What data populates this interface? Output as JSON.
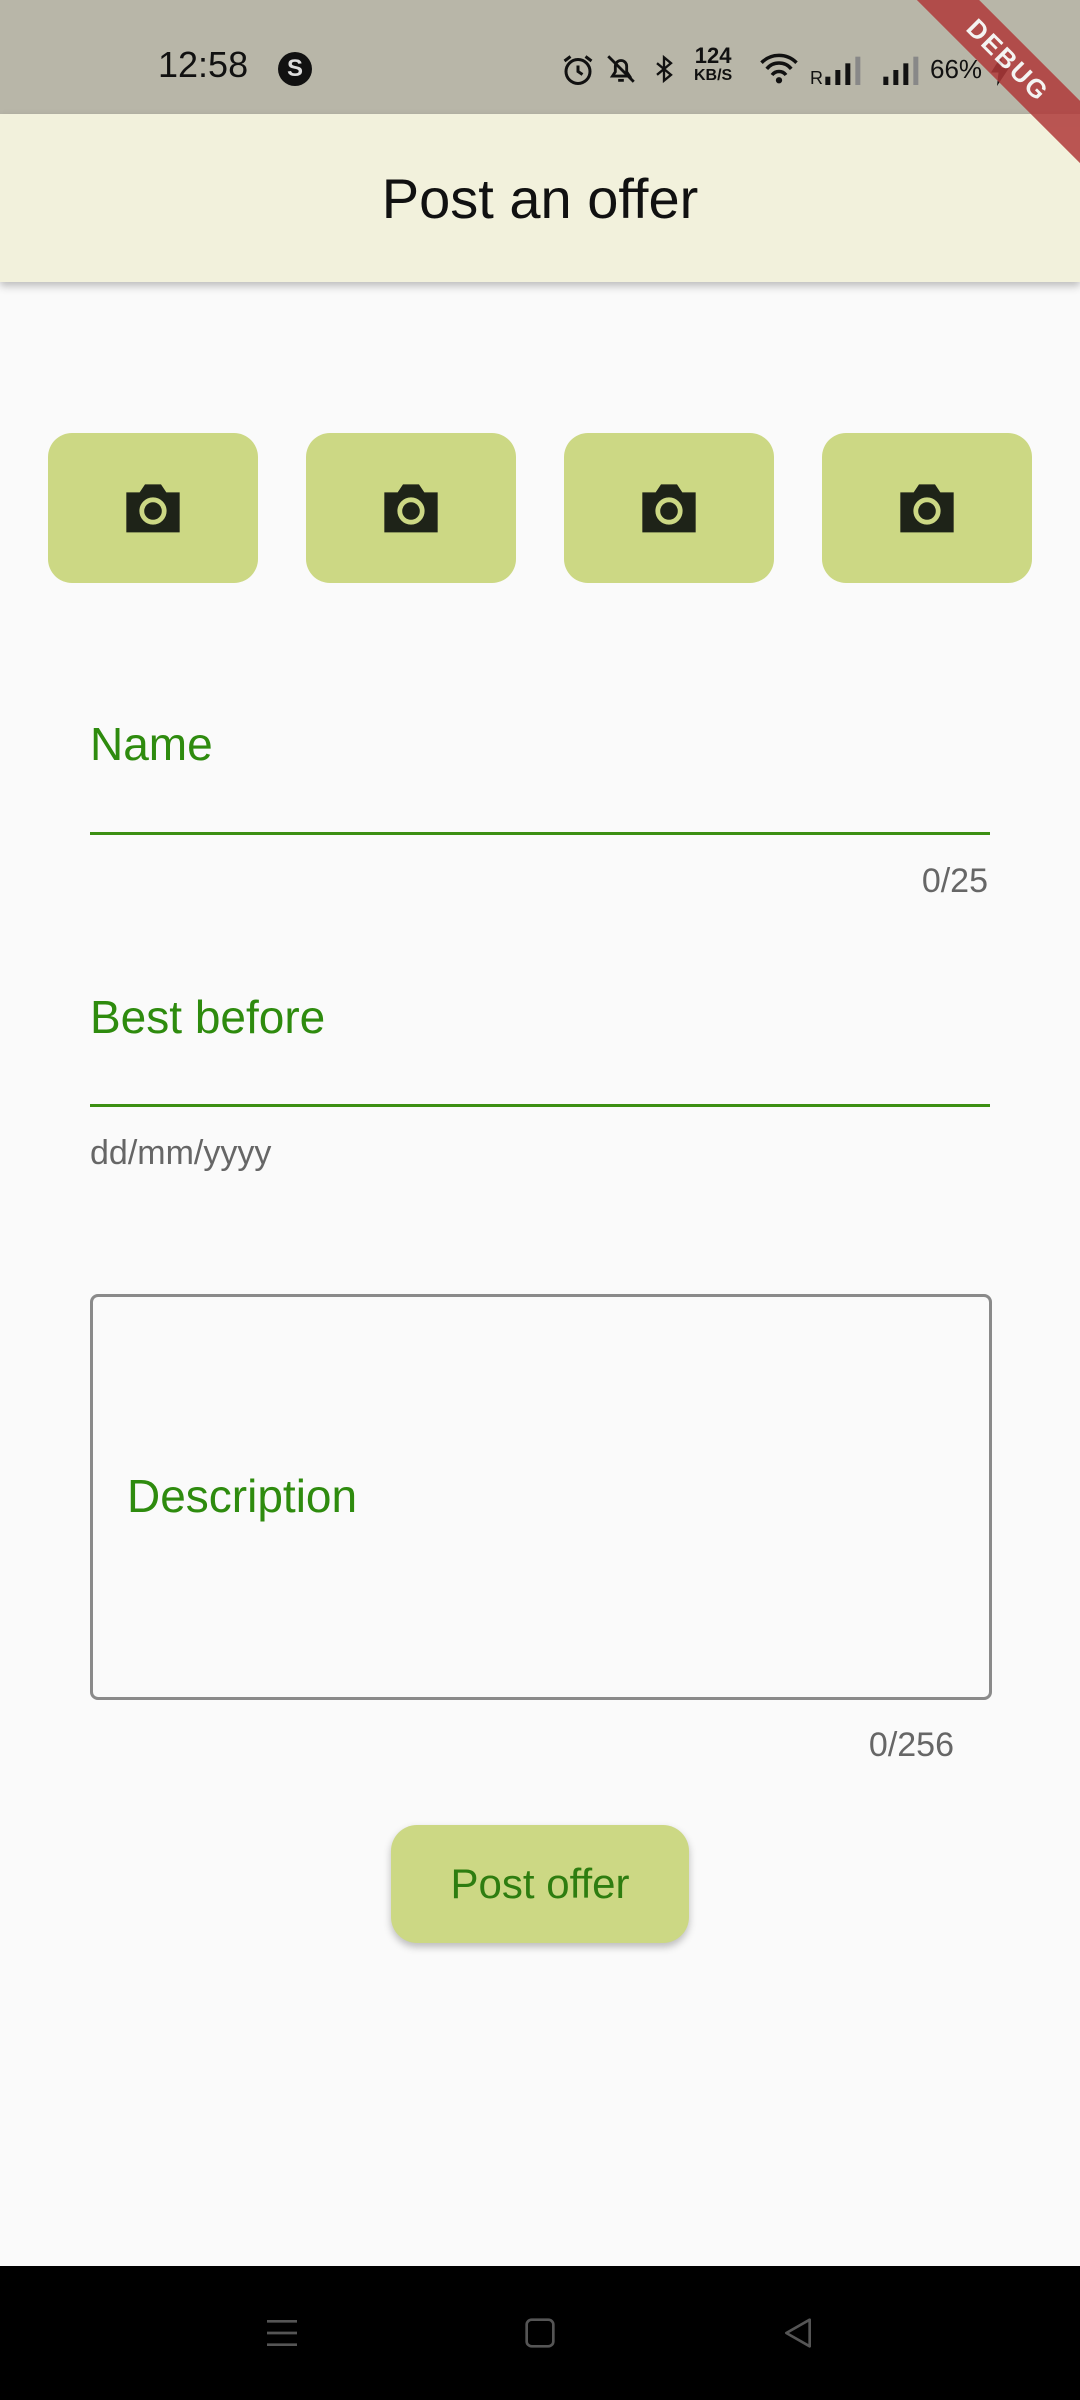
{
  "status_bar": {
    "time": "12:58",
    "app_icon_letter": "S",
    "net_speed_value": "124",
    "net_speed_unit": "KB/S",
    "signal_roaming_label": "R",
    "battery": "66%",
    "icons": [
      "alarm-icon",
      "bell-off-icon",
      "bluetooth-icon",
      "wifi-icon",
      "signal-icon",
      "signal-icon",
      "charging-icon"
    ]
  },
  "debug_banner": "DEBUG",
  "app_bar": {
    "title": "Post an offer"
  },
  "photos": {
    "slots": [
      {
        "icon": "camera-icon"
      },
      {
        "icon": "camera-icon"
      },
      {
        "icon": "camera-icon"
      },
      {
        "icon": "camera-icon"
      }
    ]
  },
  "form": {
    "name": {
      "label": "Name",
      "value": "",
      "counter": "0/25"
    },
    "best_before": {
      "label": "Best before",
      "value": "",
      "helper": "dd/mm/yyyy"
    },
    "description": {
      "label": "Description",
      "value": "",
      "counter": "0/256"
    },
    "submit_label": "Post offer"
  },
  "nav_bar": {
    "icons": [
      "menu-icon",
      "home-icon",
      "back-icon"
    ]
  },
  "colors": {
    "accent": "#2e8b0e",
    "button_fill": "#ccd884",
    "app_bar_bg": "#f2f1dc",
    "status_bar_bg": "#b8b6a8"
  }
}
